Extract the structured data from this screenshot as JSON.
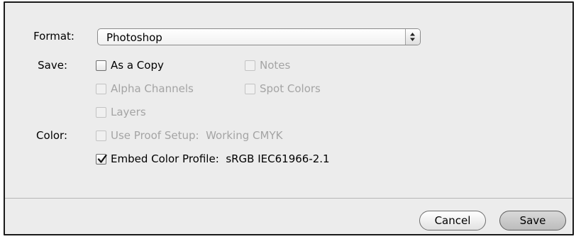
{
  "format": {
    "label": "Format:",
    "selected": "Photoshop"
  },
  "save": {
    "label": "Save:",
    "options": [
      {
        "label": "As a Copy",
        "checked": false,
        "enabled": true
      },
      {
        "label": "Notes",
        "checked": false,
        "enabled": false
      },
      {
        "label": "Alpha Channels",
        "checked": false,
        "enabled": false
      },
      {
        "label": "Spot Colors",
        "checked": false,
        "enabled": false
      },
      {
        "label": "Layers",
        "checked": false,
        "enabled": false
      }
    ]
  },
  "color": {
    "label": "Color:",
    "options": [
      {
        "label": "Use Proof Setup:",
        "value": "Working CMYK",
        "checked": false,
        "enabled": false
      },
      {
        "label": "Embed Color Profile:",
        "value": "sRGB IEC61966-2.1",
        "checked": true,
        "enabled": true
      }
    ]
  },
  "buttons": {
    "cancel": "Cancel",
    "save": "Save"
  }
}
